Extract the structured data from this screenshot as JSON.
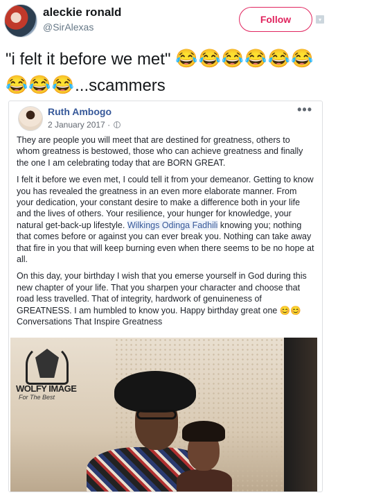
{
  "tweet": {
    "display_name": "aleckie ronald",
    "handle": "@SirAlexas",
    "follow_label": "Follow",
    "text_quote": "\"i felt it before we met\" ",
    "emoji_line1": "😂😂😂😂😂😂",
    "emoji_line2": "😂😂😂",
    "text_end": "...scammers"
  },
  "post": {
    "author": "Ruth Ambogo",
    "date": "2 January 2017 · ",
    "more": "•••",
    "p1": "They are people you will meet that are destined for greatness, others to whom greatness is bestowed, those who can achieve greatness and finally the one I am celebrating today that are BORN GREAT.",
    "p2_a": "I felt it before we even met, I could tell it from your demeanor. Getting to know you has revealed the greatness in an even more elaborate manner. From your dedication, your constant desire to make a difference both in your life and the lives of others. Your resilience, your hunger for knowledge, your natural get-back-up lifestyle. ",
    "p2_mention": "Wilkings Odinga Fadhili",
    "p2_b": " knowing you; nothing that comes before or against you can ever break you. Nothing can take away that fire in you that will keep burning even when there seems to be no hope at all.",
    "p3_a": "On this day, your birthday I wish that you emerse yourself in God during this new chapter of your life. That you sharpen your character and choose that road less travelled. That of integrity, hardwork of genuineness of GREATNESS. I am humbled to know you. Happy birthday great one 😊😊",
    "p3_b": "Conversations That Inspire Greatness"
  },
  "photo": {
    "logo_title": "WOLFY IMAGE",
    "logo_sub": "For The Best"
  },
  "colors": {
    "follow": "#e0245e",
    "link": "#365899",
    "handle": "#657786"
  },
  "icons": [
    "globe-icon",
    "more-icon",
    "caret-icon"
  ]
}
